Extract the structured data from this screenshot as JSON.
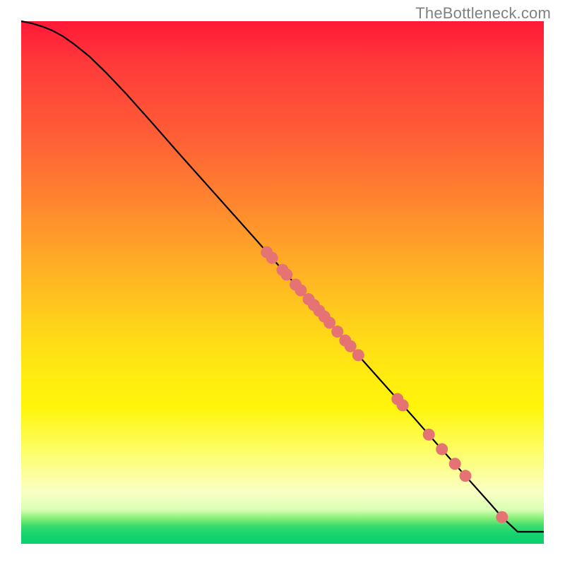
{
  "watermark": "TheBottleneck.com",
  "colors": {
    "curve": "#000000",
    "marker_fill": "#e57373",
    "marker_stroke": "#c85a5a"
  },
  "chart_data": {
    "type": "line",
    "title": "",
    "xlabel": "",
    "ylabel": "",
    "xlim": [
      0,
      100
    ],
    "ylim": [
      0,
      100
    ],
    "series": [
      {
        "name": "curve",
        "kind": "line",
        "x": [
          0,
          2,
          4,
          6,
          8,
          10,
          13,
          16,
          20,
          25,
          30,
          35,
          40,
          45,
          50,
          55,
          60,
          65,
          70,
          75,
          80,
          85,
          90,
          92,
          95,
          100
        ],
        "y": [
          100,
          99.6,
          99.0,
          98.2,
          97.1,
          95.7,
          93.3,
          90.4,
          86.2,
          80.6,
          74.9,
          69.3,
          63.7,
          58.1,
          52.4,
          46.8,
          41.2,
          35.5,
          29.9,
          24.3,
          18.6,
          13.0,
          7.4,
          5.1,
          2.3,
          2.3
        ],
        "_comment": "monotone decreasing curve, convex-ish near top, nearly linear through the middle, flattens at the very bottom (y≈2.3 plateau)"
      },
      {
        "name": "markers",
        "kind": "scatter",
        "x": [
          47,
          48,
          50,
          50.8,
          52.5,
          53.5,
          55,
          56,
          57,
          58,
          59,
          60.5,
          62,
          63,
          64.5,
          72,
          73,
          78,
          80.5,
          83,
          85,
          92
        ],
        "y": [
          55.8,
          54.7,
          52.4,
          51.5,
          49.6,
          48.5,
          46.8,
          45.7,
          44.6,
          43.5,
          42.3,
          40.6,
          38.9,
          37.8,
          36.1,
          27.7,
          26.5,
          20.9,
          18.1,
          15.3,
          13.0,
          5.1
        ],
        "_comment": "salmon dots lying on the curve, clustered mid-to-lower-right segment"
      }
    ]
  }
}
